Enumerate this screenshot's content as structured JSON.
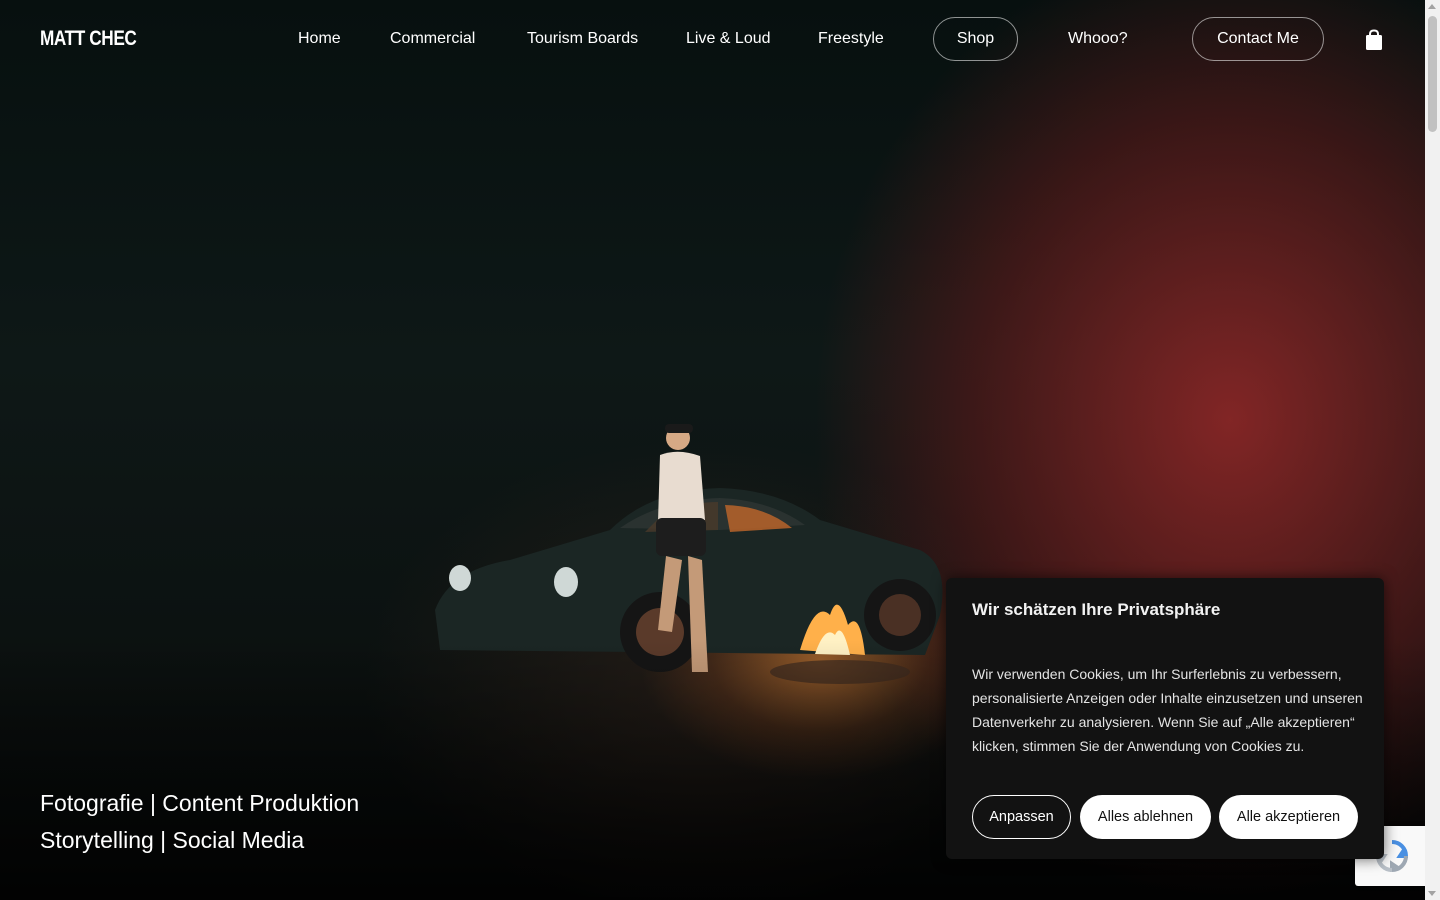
{
  "brand": {
    "logo_text": "MATT CHEC"
  },
  "nav": {
    "items": [
      {
        "label": "Home"
      },
      {
        "label": "Commercial"
      },
      {
        "label": "Tourism Boards"
      },
      {
        "label": "Live & Loud"
      },
      {
        "label": "Freestyle"
      },
      {
        "label": "Shop"
      },
      {
        "label": "Whooo?"
      },
      {
        "label": "Contact Me"
      }
    ],
    "cart_icon": "shopping-bag-icon"
  },
  "hero": {
    "tagline_line1": "Fotografie | Content Produktion",
    "tagline_line2": "Storytelling | Social Media"
  },
  "cookie_banner": {
    "title": "Wir schätzen Ihre Privatsphäre",
    "body": "Wir verwenden Cookies, um Ihr Surferlebnis zu verbessern, personalisierte Anzeigen oder Inhalte einzusetzen und unseren Datenverkehr zu analysieren. Wenn Sie auf „Alle akzeptieren“ klicken, stimmen Sie der Anwendung von Cookies zu.",
    "customize_label": "Anpassen",
    "reject_label": "Alles ablehnen",
    "accept_label": "Alle akzeptieren"
  },
  "colors": {
    "page_bg": "#0b0d0d",
    "dialog_bg": "#121212",
    "button_light": "#ffffff",
    "text_primary": "#ffffff"
  }
}
